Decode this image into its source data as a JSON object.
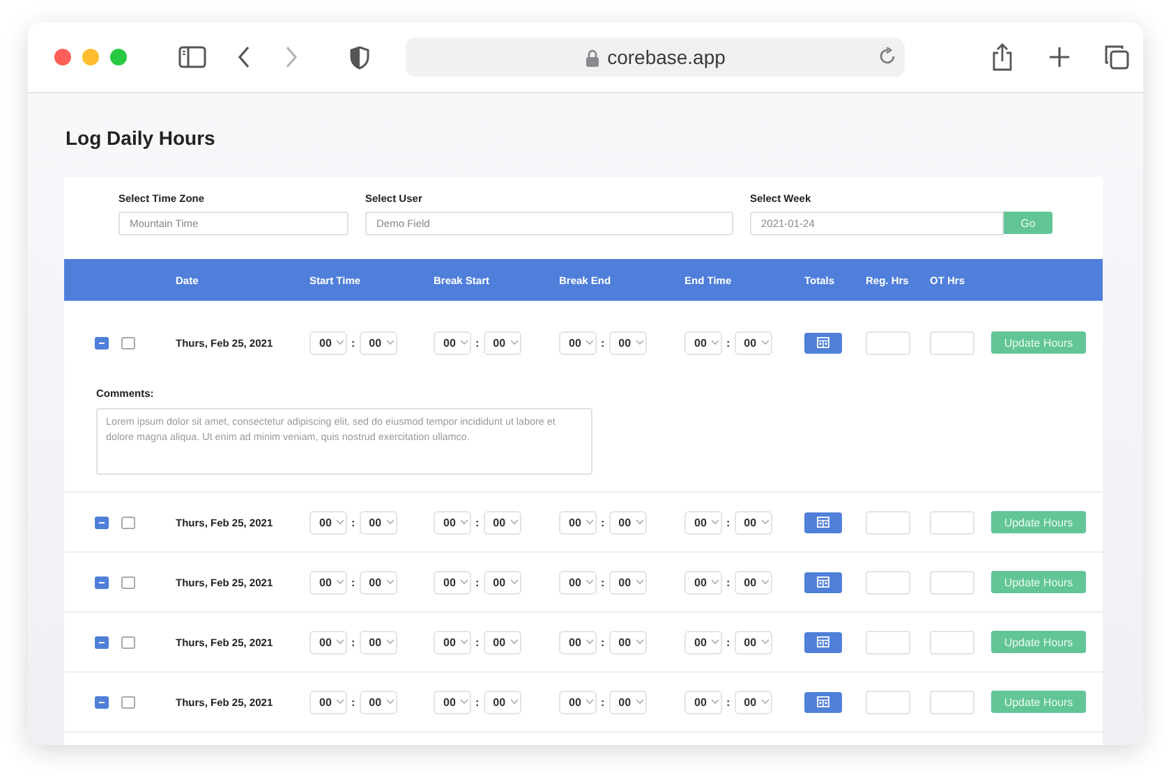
{
  "browser": {
    "address": "corebase.app",
    "forward_disabled": true
  },
  "page_title": "Log Daily Hours",
  "filters": [
    {
      "label": "Select Time Zone",
      "value": "Mountain Time"
    },
    {
      "label": "Select User",
      "value": "Demo Field"
    },
    {
      "label": "Select Week",
      "value": "2021-01-24",
      "button": "Go"
    }
  ],
  "table": {
    "columns": [
      "Date",
      "Start Time",
      "Break Start",
      "Break End",
      "End Time",
      "Totals",
      "Reg. Hrs",
      "OT Hrs"
    ],
    "rows": [
      {
        "expanded": true,
        "checked": false,
        "date": "Thurs, Feb 25, 2021",
        "times": [
          {
            "hour": "00",
            "separator": ":",
            "minute": "00"
          },
          {
            "hour": "00",
            "separator": ":",
            "minute": "00"
          },
          {
            "hour": "00",
            "separator": ":",
            "minute": "00"
          },
          {
            "hour": "00",
            "separator": ":",
            "minute": "00"
          }
        ],
        "button": "Update Hours",
        "comments": {
          "label": "Comments:",
          "placeholder": "Lorem ipsum dolor sit amet, consectetur adipiscing elit, sed do eiusmod tempor incididunt ut labore et dolore magna aliqua. Ut enim ad minim veniam, quis nostrud exercitation ullamco."
        }
      },
      {
        "expanded": true,
        "checked": false,
        "date": "Thurs, Feb 25, 2021",
        "times": [
          {
            "hour": "00",
            "separator": ":",
            "minute": "00"
          },
          {
            "hour": "00",
            "separator": ":",
            "minute": "00"
          },
          {
            "hour": "00",
            "separator": ":",
            "minute": "00"
          },
          {
            "hour": "00",
            "separator": ":",
            "minute": "00"
          }
        ],
        "button": "Update Hours"
      },
      {
        "expanded": true,
        "checked": false,
        "date": "Thurs, Feb 25, 2021",
        "times": [
          {
            "hour": "00",
            "separator": ":",
            "minute": "00"
          },
          {
            "hour": "00",
            "separator": ":",
            "minute": "00"
          },
          {
            "hour": "00",
            "separator": ":",
            "minute": "00"
          },
          {
            "hour": "00",
            "separator": ":",
            "minute": "00"
          }
        ],
        "button": "Update Hours"
      },
      {
        "expanded": true,
        "checked": false,
        "date": "Thurs, Feb 25, 2021",
        "times": [
          {
            "hour": "00",
            "separator": ":",
            "minute": "00"
          },
          {
            "hour": "00",
            "separator": ":",
            "minute": "00"
          },
          {
            "hour": "00",
            "separator": ":",
            "minute": "00"
          },
          {
            "hour": "00",
            "separator": ":",
            "minute": "00"
          }
        ],
        "button": "Update Hours"
      },
      {
        "expanded": true,
        "checked": false,
        "date": "Thurs, Feb 25, 2021",
        "times": [
          {
            "hour": "00",
            "separator": ":",
            "minute": "00"
          },
          {
            "hour": "00",
            "separator": ":",
            "minute": "00"
          },
          {
            "hour": "00",
            "separator": ":",
            "minute": "00"
          },
          {
            "hour": "00",
            "separator": ":",
            "minute": "00"
          }
        ],
        "button": "Update Hours"
      }
    ]
  }
}
